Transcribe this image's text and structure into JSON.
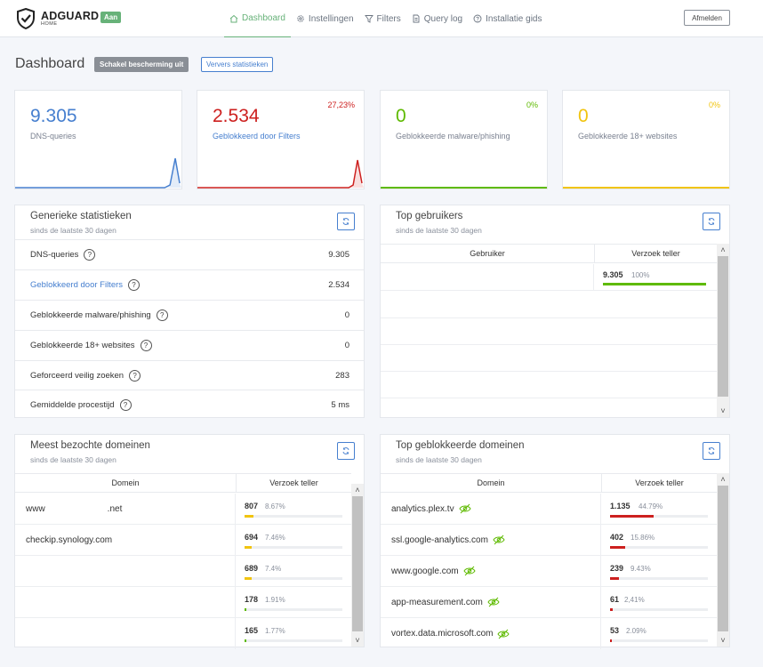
{
  "header": {
    "brand": "ADGUARD",
    "brand_sub": "HOME",
    "status_badge": "Aan",
    "nav": [
      {
        "label": "Dashboard",
        "icon": "home-icon",
        "active": true
      },
      {
        "label": "Instellingen",
        "icon": "gear-icon",
        "active": false
      },
      {
        "label": "Filters",
        "icon": "filter-icon",
        "active": false
      },
      {
        "label": "Query log",
        "icon": "document-icon",
        "active": false
      },
      {
        "label": "Installatie gids",
        "icon": "help-circle-icon",
        "active": false
      }
    ],
    "signout": "Afmelden"
  },
  "page": {
    "title": "Dashboard",
    "btn_disable": "Schakel bescherming uit",
    "btn_refresh": "Ververs statistieken"
  },
  "stats": [
    {
      "value": "9.305",
      "label": "DNS-queries",
      "pct": "",
      "color": "#467fcf",
      "label_color": "#7a8190"
    },
    {
      "value": "2.534",
      "label": "Geblokkeerd door Filters",
      "pct": "27,23%",
      "color": "#cd201f",
      "label_color": "#467fcf"
    },
    {
      "value": "0",
      "label": "Geblokkeerde malware/phishing",
      "pct": "0%",
      "color": "#5eba00",
      "label_color": "#7a8190"
    },
    {
      "value": "0",
      "label": "Geblokkeerde 18+ websites",
      "pct": "0%",
      "color": "#f1c40f",
      "label_color": "#7a8190"
    }
  ],
  "general": {
    "title": "Generieke statistieken",
    "subtitle": "sinds de laatste 30 dagen",
    "rows": [
      {
        "label": "DNS-queries",
        "value": "9.305",
        "link": false
      },
      {
        "label": "Geblokkeerd door Filters",
        "value": "2.534",
        "link": true
      },
      {
        "label": "Geblokkeerde malware/phishing",
        "value": "0",
        "link": false
      },
      {
        "label": "Geblokkeerde 18+ websites",
        "value": "0",
        "link": false
      },
      {
        "label": "Geforceerd veilig zoeken",
        "value": "283",
        "link": false
      },
      {
        "label": "Gemiddelde procestijd",
        "value": "5 ms",
        "link": false
      }
    ]
  },
  "top_clients": {
    "title": "Top gebruikers",
    "subtitle": "sinds de laatste 30 dagen",
    "col_client": "Gebruiker",
    "col_count": "Verzoek teller",
    "rows": [
      {
        "name": "",
        "count": "9.305",
        "pct": "100%",
        "fraction": 1.0
      }
    ]
  },
  "top_domains": {
    "title": "Meest bezochte domeinen",
    "subtitle": "sinds de laatste 30 dagen",
    "col_domain": "Domein",
    "col_count": "Verzoek teller",
    "bar_color": "#f1c40f",
    "rows": [
      {
        "name_a": "www",
        "name_b": ".net",
        "count": "807",
        "pct": "8.67%",
        "fraction": 0.0867
      },
      {
        "name_a": "checkip.synology.com",
        "name_b": "",
        "count": "694",
        "pct": "7.46%",
        "fraction": 0.0746
      },
      {
        "name_a": "",
        "name_b": "",
        "count": "689",
        "pct": "7.4%",
        "fraction": 0.074
      },
      {
        "name_a": "",
        "name_b": "",
        "count": "178",
        "pct": "1.91%",
        "fraction": 0.0191
      },
      {
        "name_a": "",
        "name_b": "",
        "count": "165",
        "pct": "1.77%",
        "fraction": 0.0177
      }
    ]
  },
  "top_blocked": {
    "title": "Top geblokkeerde domeinen",
    "subtitle": "sinds de laatste 30 dagen",
    "col_domain": "Domein",
    "col_count": "Verzoek teller",
    "bar_color": "#cd201f",
    "rows": [
      {
        "name": "analytics.plex.tv",
        "count": "1.135",
        "pct": "44.79%",
        "fraction": 0.4479
      },
      {
        "name": "ssl.google-analytics.com",
        "count": "402",
        "pct": "15.86%",
        "fraction": 0.1586
      },
      {
        "name": "www.google.com",
        "count": "239",
        "pct": "9.43%",
        "fraction": 0.0943
      },
      {
        "name": "app-measurement.com",
        "count": "61",
        "pct": "2,41%",
        "fraction": 0.0241
      },
      {
        "name": "vortex.data.microsoft.com",
        "count": "53",
        "pct": "2.09%",
        "fraction": 0.0209
      }
    ]
  }
}
